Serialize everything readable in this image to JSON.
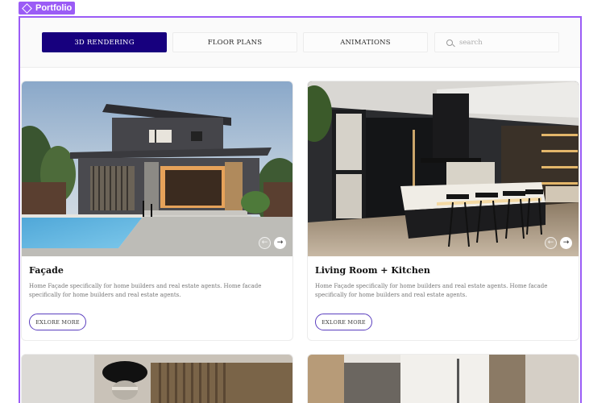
{
  "frame_label": "Portfolio",
  "nav": {
    "tabs": [
      {
        "label": "3D RENDERING",
        "active": true
      },
      {
        "label": "FLOOR PLANS",
        "active": false
      },
      {
        "label": "ANIMATIONS",
        "active": false
      }
    ],
    "search_placeholder": "search"
  },
  "cards": [
    {
      "title": "Façade",
      "description": "Home Façade specifically for home builders and real estate agents. Home facade specifically for home builders and real estate agents.",
      "button_label": "EXLORE MORE",
      "image": "modern-house-exterior-with-pool"
    },
    {
      "title": "Living Room + Kitchen",
      "description": "Home Façade specifically for home builders and real estate agents. Home facade specifically for home builders and real estate agents.",
      "button_label": "EXLORE MORE",
      "image": "dark-modern-kitchen-interior"
    },
    {
      "image": "bedroom-with-chandelier"
    },
    {
      "image": "bathroom-interior"
    }
  ],
  "colors": {
    "accent": "#17007e",
    "frame": "#9b5cf6",
    "button_border": "#5b3fbf"
  },
  "icons": {
    "search": "search-icon",
    "prev": "arrow-left-icon",
    "next": "arrow-right-icon",
    "tag": "diamond-icon"
  }
}
